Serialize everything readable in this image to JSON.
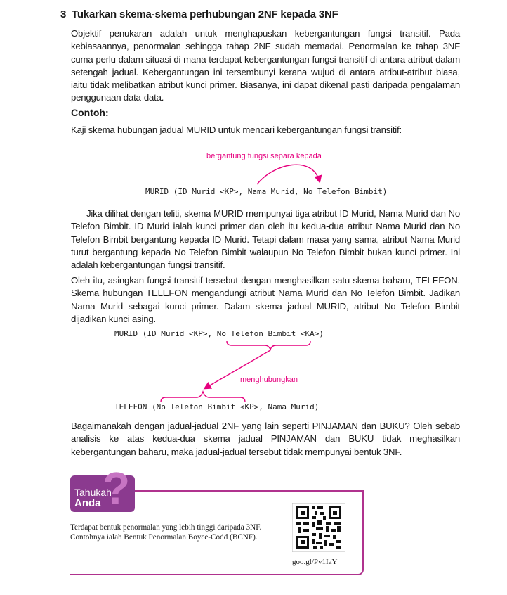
{
  "section": {
    "number": "3",
    "title": "Tukarkan skema-skema perhubungan 2NF kepada 3NF"
  },
  "paragraphs": {
    "intro": "Objektif penukaran adalah untuk menghapuskan kebergantungan fungsi transitif. Pada kebiasaannya, penormalan sehingga tahap 2NF sudah memadai. Penormalan ke tahap 3NF cuma perlu dalam situasi di mana terdapat kebergantungan fungsi transitif di antara atribut dalam setengah jadual. Kebergantungan ini tersembunyi kerana wujud di antara atribut-atribut biasa, iaitu tidak melibatkan atribut kunci primer. Biasanya, ini dapat dikenal pasti daripada pengalaman penggunaan data-data.",
    "example_heading": "Contoh:",
    "example_intro": "Kaji skema hubungan jadual MURID untuk mencari kebergantungan fungsi transitif:",
    "analysis": "Jika dilihat dengan teliti, skema MURID mempunyai tiga atribut ID Murid, Nama Murid dan No Telefon Bimbit. ID Murid ialah kunci primer dan oleh itu kedua-dua atribut Nama Murid dan No Telefon Bimbit bergantung kepada ID Murid. Tetapi dalam masa yang sama, atribut Nama Murid turut bergantung kepada No Telefon Bimbit walaupun No Telefon Bimbit bukan kunci primer. Ini adalah kebergantungan fungsi transitif.",
    "solution": "Oleh itu, asingkan fungsi transitif tersebut dengan menghasilkan satu skema baharu, TELEFON. Skema hubungan TELEFON mengandungi atribut Nama Murid dan No Telefon Bimbit. Jadikan Nama Murid sebagai kunci primer. Dalam skema jadual MURID, atribut No Telefon Bimbit dijadikan kunci asing.",
    "closing": "Bagaimanakah dengan jadual-jadual 2NF yang lain seperti PINJAMAN dan BUKU? Oleh sebab analisis ke atas kedua-dua skema jadual PINJAMAN dan BUKU tidak meghasilkan kebergantungan baharu, maka jadual-jadual tersebut tidak mempunyai bentuk 3NF."
  },
  "diagram1": {
    "annotation": "bergantung fungsi separa kepada",
    "schema": "MURID (ID Murid <KP>, Nama Murid, No Telefon Bimbit)"
  },
  "diagram2": {
    "schema_top_prefix": "MURID (ID Murid <KP>, ",
    "schema_top_fk": "No Telefon Bimbit",
    "schema_top_suffix": " <KA>)",
    "annotation": "menghubungkan",
    "schema_bottom_prefix": "TELEFON (",
    "schema_bottom_key": "No Telefon Bimbit",
    "schema_bottom_suffix": " <KP>, Nama Murid)"
  },
  "info_box": {
    "label_line1": "Tahukah",
    "label_line2": "Anda",
    "question_mark": "?",
    "note": "Terdapat bentuk penormalan yang lebih tinggi daripada 3NF. Contohnya ialah Bentuk Penormalan Boyce-Codd (BCNF).",
    "qr_icon": "qr-code-icon",
    "link": "goo.gl/Pv1IaY"
  },
  "colors": {
    "annotation": "#e6007e",
    "box_border": "#b0328e",
    "badge": "#8b3a8f"
  }
}
